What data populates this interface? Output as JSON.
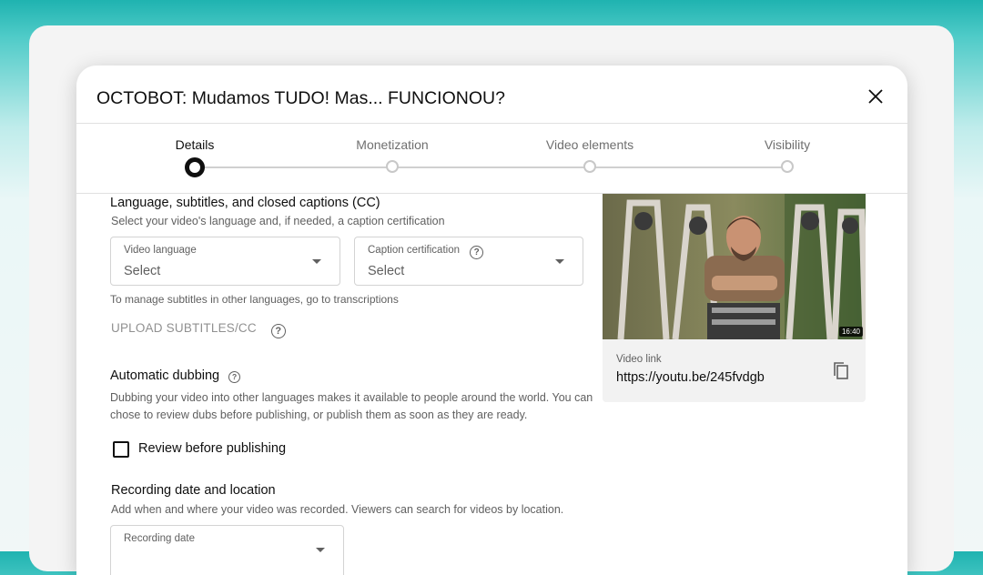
{
  "dialog": {
    "title": "OCTOBOT: Mudamos TUDO! Mas... FUNCIONOU?"
  },
  "steps": [
    {
      "label": "Details",
      "active": true
    },
    {
      "label": "Monetization",
      "active": false
    },
    {
      "label": "Video elements",
      "active": false
    },
    {
      "label": "Visibility",
      "active": false
    }
  ],
  "language_section": {
    "title": "Language, subtitles, and closed captions (CC)",
    "description": "Select your video's language and, if needed, a caption certification",
    "video_language": {
      "label": "Video language",
      "value": "Select"
    },
    "caption_certification": {
      "label": "Caption certification",
      "value": "Select"
    },
    "note": "To manage subtitles in other languages, go to transcriptions",
    "upload_label": "UPLOAD SUBTITLES/CC"
  },
  "dubbing_section": {
    "title": "Automatic dubbing",
    "description_line1": "Dubbing your video into other languages makes it available to people around the world. You can",
    "description_line2": "chose to review dubs before publishing, or publish them as soon as they are ready.",
    "checkbox_label": "Review before publishing",
    "checked": false
  },
  "recording_section": {
    "title": "Recording date and location",
    "description": "Add when and where your video was recorded. Viewers can search for videos by location.",
    "recording_date": {
      "label": "Recording date"
    }
  },
  "video_panel": {
    "duration": "16:40",
    "link_label": "Video link",
    "link_value": "https://youtu.be/245fvdgb"
  },
  "colors": {
    "accent_teal": "#1fb3b0",
    "text_primary": "#0f0f0f",
    "text_secondary": "#606060"
  }
}
